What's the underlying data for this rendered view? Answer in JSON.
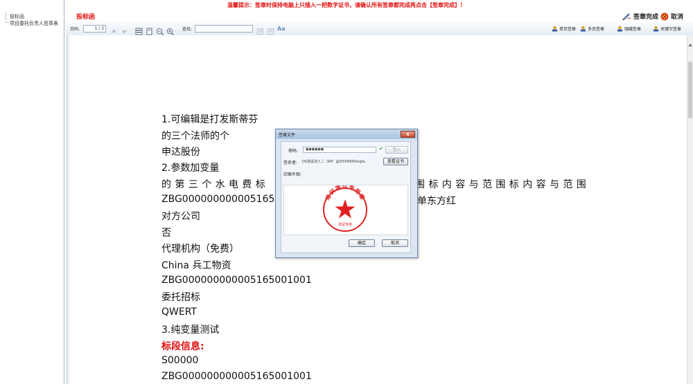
{
  "warning": "温馨提示：签章时保持电脑上只插入一把数字证书，请确认所有签章都完成再点击【签章完成】！",
  "doc_title": "投标函",
  "sidebar": {
    "items": [
      {
        "label": "投标函"
      },
      {
        "label": "项目委托负责人签章表"
      }
    ]
  },
  "actions": {
    "finish_label": "签章完成",
    "cancel_label": "取消"
  },
  "toolbar": {
    "page_label": "页码:",
    "page_value": "1 / 3",
    "search_label": "查找:",
    "search_value": "",
    "right_items": [
      {
        "label": "单页签章",
        "icon": "stamp-icon"
      },
      {
        "label": "多页签章",
        "icon": "stamp-icon"
      },
      {
        "label": "骑缝签章",
        "icon": "stamp-icon"
      },
      {
        "label": "关键字签章",
        "icon": "stamp-icon"
      }
    ]
  },
  "document": {
    "lines": [
      {
        "text": "1.可编辑是打发斯蒂芬",
        "style": "normal"
      },
      {
        "text": "的三个法师的个",
        "style": "normal"
      },
      {
        "text": "申达股份",
        "style": "normal"
      },
      {
        "text": "2.参数加变量",
        "style": "normal"
      },
      {
        "text": "的第三个水电费标",
        "style": "spaced"
      },
      {
        "text": "ZBG000000000005165001",
        "style": "normal"
      },
      {
        "text": "对方公司",
        "style": "normal"
      },
      {
        "text": "否",
        "style": "normal"
      },
      {
        "text": "代理机构（免费）",
        "style": "normal"
      },
      {
        "text": "China 兵工物资",
        "style": "normal"
      },
      {
        "text": "ZBG000000000005165001001",
        "style": "normal"
      },
      {
        "text": "委托招标",
        "style": "normal"
      },
      {
        "text": "QWERT",
        "style": "normal"
      },
      {
        "text": "3.纯变量测试",
        "style": "normal"
      },
      {
        "text": "标段信息:",
        "style": "red"
      },
      {
        "text": "S00000",
        "style": "normal"
      },
      {
        "text": "ZBG000000000005165001001",
        "style": "normal"
      }
    ],
    "overflow_right_1": "围标内容与范围标内容与范围",
    "overflow_right_2": "单东方红"
  },
  "dialog": {
    "title": "签章文件",
    "close": "x",
    "password_label": "密码:",
    "password_value": "●●●●●●",
    "login_button": "登入",
    "signer_label": "签名者:",
    "signer_value": "DS测试法人二（RP）@D5300000vgta",
    "view_cert_button": "查看证书",
    "seal_preview_label": "印章外观:",
    "seal_ring_text": "培训测试专用章",
    "seal_bottom_text": "测试专用",
    "ok_button": "确定",
    "cancel_button": "取消"
  },
  "colors": {
    "warning_red": "#e01010",
    "seal_red": "#e02020",
    "check_green": "#2a9a2a"
  }
}
